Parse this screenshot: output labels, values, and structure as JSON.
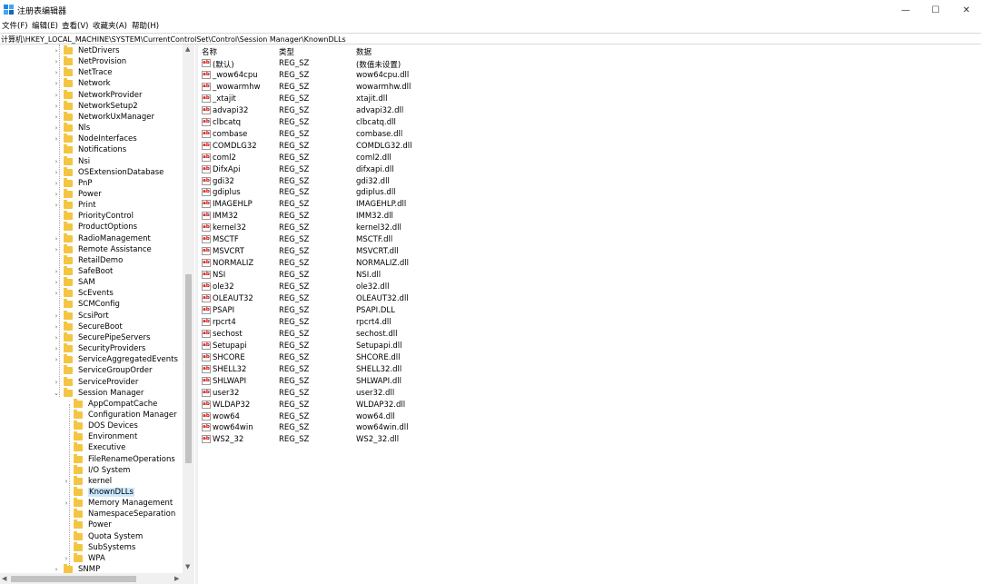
{
  "window": {
    "title": "注册表编辑器",
    "minimize_label": "—",
    "maximize_label": "☐",
    "close_label": "✕"
  },
  "menu": [
    "文件(F)",
    "编辑(E)",
    "查看(V)",
    "收藏夹(A)",
    "帮助(H)"
  ],
  "address": "计算机\\HKEY_LOCAL_MACHINE\\SYSTEM\\CurrentControlSet\\Control\\Session Manager\\KnownDLLs",
  "tree": [
    {
      "label": "NetDrivers",
      "expandable": true
    },
    {
      "label": "NetProvision",
      "expandable": true
    },
    {
      "label": "NetTrace",
      "expandable": true
    },
    {
      "label": "Network",
      "expandable": true
    },
    {
      "label": "NetworkProvider",
      "expandable": true
    },
    {
      "label": "NetworkSetup2",
      "expandable": true
    },
    {
      "label": "NetworkUxManager",
      "expandable": true
    },
    {
      "label": "Nls",
      "expandable": true
    },
    {
      "label": "NodeInterfaces",
      "expandable": true
    },
    {
      "label": "Notifications",
      "expandable": false
    },
    {
      "label": "Nsi",
      "expandable": true
    },
    {
      "label": "OSExtensionDatabase",
      "expandable": true
    },
    {
      "label": "PnP",
      "expandable": true
    },
    {
      "label": "Power",
      "expandable": true
    },
    {
      "label": "Print",
      "expandable": true
    },
    {
      "label": "PriorityControl",
      "expandable": false
    },
    {
      "label": "ProductOptions",
      "expandable": false
    },
    {
      "label": "RadioManagement",
      "expandable": true
    },
    {
      "label": "Remote Assistance",
      "expandable": true
    },
    {
      "label": "RetailDemo",
      "expandable": false
    },
    {
      "label": "SafeBoot",
      "expandable": true
    },
    {
      "label": "SAM",
      "expandable": true
    },
    {
      "label": "ScEvents",
      "expandable": true
    },
    {
      "label": "SCMConfig",
      "expandable": false
    },
    {
      "label": "ScsiPort",
      "expandable": true
    },
    {
      "label": "SecureBoot",
      "expandable": true
    },
    {
      "label": "SecurePipeServers",
      "expandable": true
    },
    {
      "label": "SecurityProviders",
      "expandable": true
    },
    {
      "label": "ServiceAggregatedEvents",
      "expandable": true
    },
    {
      "label": "ServiceGroupOrder",
      "expandable": false
    },
    {
      "label": "ServiceProvider",
      "expandable": true
    },
    {
      "label": "Session Manager",
      "expandable": true,
      "expanded": true
    },
    {
      "label": "AppCompatCache",
      "expandable": false,
      "child": true
    },
    {
      "label": "Configuration Manager",
      "expandable": false,
      "child": true
    },
    {
      "label": "DOS Devices",
      "expandable": false,
      "child": true
    },
    {
      "label": "Environment",
      "expandable": false,
      "child": true
    },
    {
      "label": "Executive",
      "expandable": false,
      "child": true
    },
    {
      "label": "FileRenameOperations",
      "expandable": false,
      "child": true
    },
    {
      "label": "I/O System",
      "expandable": false,
      "child": true
    },
    {
      "label": "kernel",
      "expandable": true,
      "child": true
    },
    {
      "label": "KnownDLLs",
      "expandable": false,
      "child": true,
      "selected": true
    },
    {
      "label": "Memory Management",
      "expandable": true,
      "child": true
    },
    {
      "label": "NamespaceSeparation",
      "expandable": false,
      "child": true
    },
    {
      "label": "Power",
      "expandable": false,
      "child": true
    },
    {
      "label": "Quota System",
      "expandable": false,
      "child": true
    },
    {
      "label": "SubSystems",
      "expandable": false,
      "child": true
    },
    {
      "label": "WPA",
      "expandable": true,
      "child": true
    },
    {
      "label": "SNMP",
      "expandable": true
    }
  ],
  "columns": {
    "name": "名称",
    "type": "类型",
    "data": "数据"
  },
  "values": [
    {
      "name": "(默认)",
      "type": "REG_SZ",
      "data": "(数值未设置)"
    },
    {
      "name": "_wow64cpu",
      "type": "REG_SZ",
      "data": "wow64cpu.dll"
    },
    {
      "name": "_wowarmhw",
      "type": "REG_SZ",
      "data": "wowarmhw.dll"
    },
    {
      "name": "_xtajit",
      "type": "REG_SZ",
      "data": "xtajit.dll"
    },
    {
      "name": "advapi32",
      "type": "REG_SZ",
      "data": "advapi32.dll"
    },
    {
      "name": "clbcatq",
      "type": "REG_SZ",
      "data": "clbcatq.dll"
    },
    {
      "name": "combase",
      "type": "REG_SZ",
      "data": "combase.dll"
    },
    {
      "name": "COMDLG32",
      "type": "REG_SZ",
      "data": "COMDLG32.dll"
    },
    {
      "name": "coml2",
      "type": "REG_SZ",
      "data": "coml2.dll"
    },
    {
      "name": "DifxApi",
      "type": "REG_SZ",
      "data": "difxapi.dll"
    },
    {
      "name": "gdi32",
      "type": "REG_SZ",
      "data": "gdi32.dll"
    },
    {
      "name": "gdiplus",
      "type": "REG_SZ",
      "data": "gdiplus.dll"
    },
    {
      "name": "IMAGEHLP",
      "type": "REG_SZ",
      "data": "IMAGEHLP.dll"
    },
    {
      "name": "IMM32",
      "type": "REG_SZ",
      "data": "IMM32.dll"
    },
    {
      "name": "kernel32",
      "type": "REG_SZ",
      "data": "kernel32.dll"
    },
    {
      "name": "MSCTF",
      "type": "REG_SZ",
      "data": "MSCTF.dll"
    },
    {
      "name": "MSVCRT",
      "type": "REG_SZ",
      "data": "MSVCRT.dll"
    },
    {
      "name": "NORMALIZ",
      "type": "REG_SZ",
      "data": "NORMALIZ.dll"
    },
    {
      "name": "NSI",
      "type": "REG_SZ",
      "data": "NSI.dll"
    },
    {
      "name": "ole32",
      "type": "REG_SZ",
      "data": "ole32.dll"
    },
    {
      "name": "OLEAUT32",
      "type": "REG_SZ",
      "data": "OLEAUT32.dll"
    },
    {
      "name": "PSAPI",
      "type": "REG_SZ",
      "data": "PSAPI.DLL"
    },
    {
      "name": "rpcrt4",
      "type": "REG_SZ",
      "data": "rpcrt4.dll"
    },
    {
      "name": "sechost",
      "type": "REG_SZ",
      "data": "sechost.dll"
    },
    {
      "name": "Setupapi",
      "type": "REG_SZ",
      "data": "Setupapi.dll"
    },
    {
      "name": "SHCORE",
      "type": "REG_SZ",
      "data": "SHCORE.dll"
    },
    {
      "name": "SHELL32",
      "type": "REG_SZ",
      "data": "SHELL32.dll"
    },
    {
      "name": "SHLWAPI",
      "type": "REG_SZ",
      "data": "SHLWAPI.dll"
    },
    {
      "name": "user32",
      "type": "REG_SZ",
      "data": "user32.dll"
    },
    {
      "name": "WLDAP32",
      "type": "REG_SZ",
      "data": "WLDAP32.dll"
    },
    {
      "name": "wow64",
      "type": "REG_SZ",
      "data": "wow64.dll"
    },
    {
      "name": "wow64win",
      "type": "REG_SZ",
      "data": "wow64win.dll"
    },
    {
      "name": "WS2_32",
      "type": "REG_SZ",
      "data": "WS2_32.dll"
    }
  ],
  "value_icon": "ab",
  "colors": {
    "folder": "#f4c542",
    "selection": "#cce8ff",
    "value_icon_text": "#cc0000"
  }
}
